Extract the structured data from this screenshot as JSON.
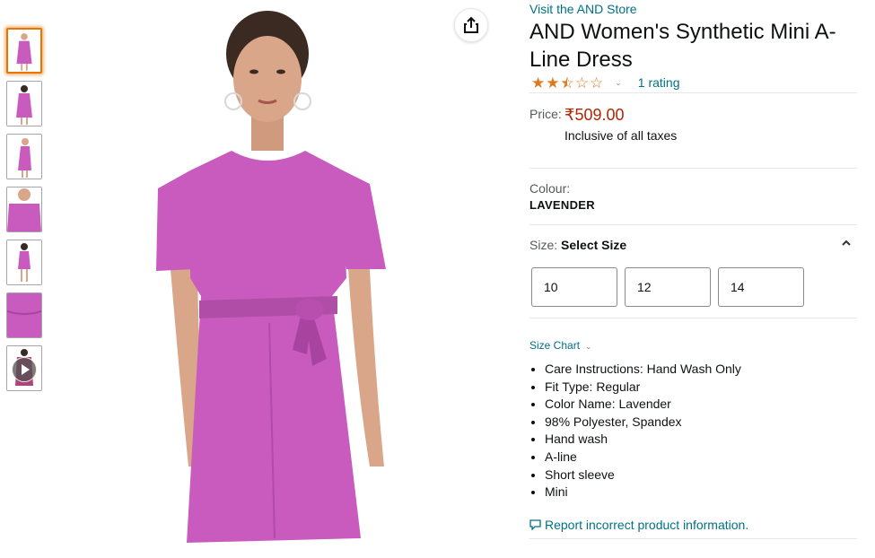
{
  "thumbnails": [
    {
      "name": "thumbnail-front",
      "active": true
    },
    {
      "name": "thumbnail-front-2"
    },
    {
      "name": "thumbnail-side"
    },
    {
      "name": "thumbnail-closeup"
    },
    {
      "name": "thumbnail-back"
    },
    {
      "name": "thumbnail-fabric"
    },
    {
      "name": "thumbnail-video",
      "video": true
    }
  ],
  "colors": {
    "dress": "#c95bbf",
    "dress_shadow": "#a8449f",
    "skin": "#d9a68a",
    "hair": "#3b2a22",
    "link": "#007185",
    "price": "#b12704",
    "star": "#de7921",
    "active_border": "#e77600"
  },
  "product": {
    "store_link": "Visit the AND Store",
    "title": "AND Women's Synthetic Mini A-Line Dress",
    "rating_stars": 2.5,
    "rating_count": "1 rating",
    "price_label": "Price:",
    "price": "₹509.00",
    "tax_note": "Inclusive of all taxes",
    "colour_label": "Colour:",
    "colour_value": "LAVENDER",
    "size_label": "Size:",
    "size_selected": "Select Size",
    "sizes": [
      "10",
      "12",
      "14"
    ],
    "size_chart": "Size Chart",
    "bullets": [
      "Care Instructions: Hand Wash Only",
      "Fit Type: Regular",
      "Color Name: Lavender",
      "98% Polyester, Spandex",
      "Hand wash",
      "A-line",
      "Short sleeve",
      "Mini"
    ],
    "report_link": "Report incorrect product information."
  },
  "icons": {
    "share": "share-icon",
    "chevron_up": "chevron-up-icon",
    "chevron_down": "chevron-down-icon",
    "report": "speech-bubble-icon",
    "play": "play-icon"
  }
}
